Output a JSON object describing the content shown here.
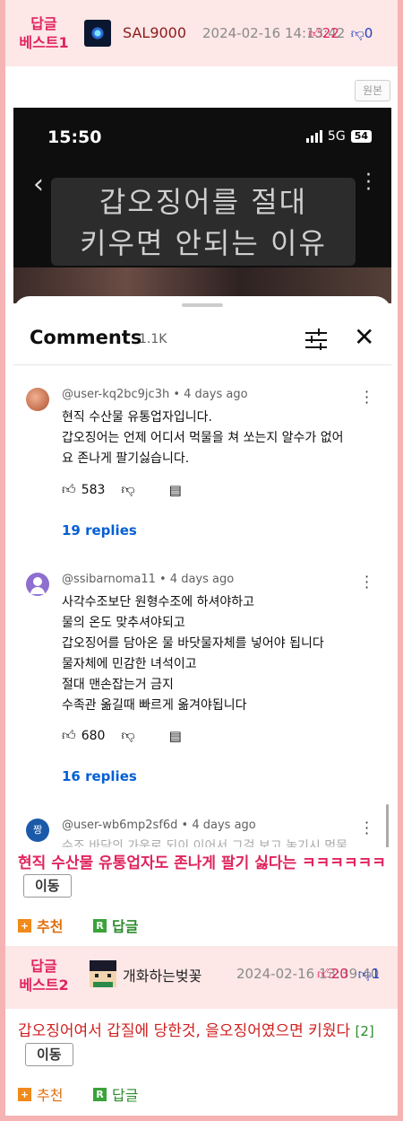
{
  "posts": [
    {
      "badge": "답글\n베스트1",
      "nick": "SAL9000",
      "date": "2024-02-16 14:13:42",
      "up": "22",
      "down": "0",
      "original_button": "원본",
      "text": "현직 수산물 유통업자도 존나게 팔기 싫다는 ㅋㅋㅋㅋㅋㅋ",
      "move_button": "이동",
      "recommend": "추천",
      "reply": "답글"
    },
    {
      "badge": "답글\n베스트2",
      "nick": "개화하는벚꽃",
      "date": "2024-02-16 13:39:40",
      "up": "20",
      "down": "1",
      "text": "갑오징어여서 갑질에 당한것, 을오징어였으면 키웠다",
      "count": "[2]",
      "move_button": "이동",
      "recommend": "추천",
      "reply": "답글"
    }
  ],
  "screenshot": {
    "time": "15:50",
    "network": "5G",
    "battery": "54",
    "caption_line1": "갑오징어를 절대",
    "caption_line2": "키우면 안되는 이유",
    "comments_title": "Comments",
    "comments_count": "1.1K",
    "comments": [
      {
        "handle": "@user-kq2bc9jc3h • 4 days ago",
        "lines": [
          "현직 수산물 유통업자입니다.",
          "갑오징어는 언제 어디서 먹물을 쳐 쏘는지 알수가 없어",
          "요 존나게 팔기싫습니다."
        ],
        "likes": "583",
        "replies": "19 replies",
        "avatar_color": "#c87050"
      },
      {
        "handle": "@ssibarnoma11 • 4 days ago",
        "lines": [
          "사각수조보단 원형수조에 하셔야하고",
          "물의 온도 맞추셔야되고",
          "갑오징어를 담아온 물 바닷물자체를 넣어야 됩니다",
          "물자체에 민감한 녀석이고",
          "절대 맨손잡는거 금지",
          "수족관 옮길때 빠르게 옮겨야됩니다"
        ],
        "likes": "680",
        "replies": "16 replies",
        "avatar_color": "#8e6fd0"
      },
      {
        "handle": "@user-wb6mp2sf6d • 4 days ago",
        "avatar_label": "짱",
        "avatar_color": "#1a5aa8",
        "partial": "수조 바닥의 가운로 되이 이어서 그걸 보고 놓기시 먹물"
      }
    ]
  }
}
